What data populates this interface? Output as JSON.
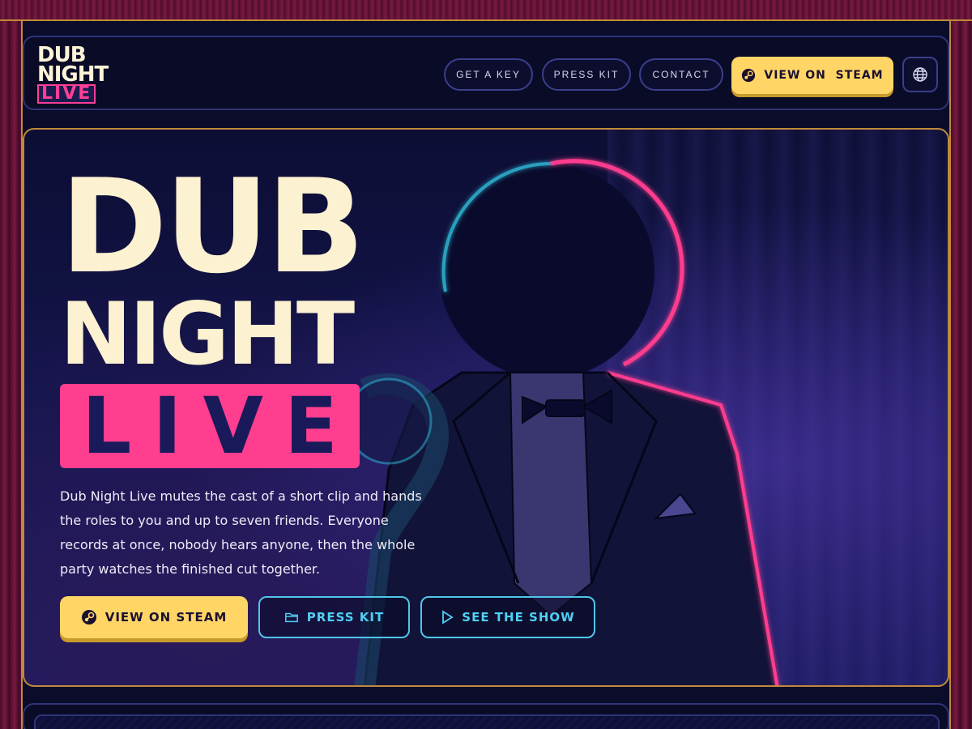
{
  "header": {
    "logo": {
      "line1": "DUB",
      "line2": "NIGHT",
      "line3": "LIVE"
    },
    "nav": [
      {
        "label": "GET A KEY"
      },
      {
        "label": "PRESS KIT"
      },
      {
        "label": "CONTACT"
      }
    ],
    "steam_button_label": "VIEW ON  STEAM",
    "globe_icon": "globe-icon"
  },
  "hero": {
    "title_line1": "DUB",
    "title_line2": "NIGHT",
    "title_line3_letters": [
      "L",
      "I",
      "V",
      "E"
    ],
    "description": "Dub Night Live mutes the cast of a short clip and hands the roles to you and up to seven friends. Everyone records at once, nobody hears anyone, then the whole party watches the finished cut together.",
    "buttons": {
      "steam": "VIEW ON STEAM",
      "press_kit": "PRESS KIT",
      "see_show": "SEE THE SHOW"
    }
  },
  "colors": {
    "accent_yellow": "#ffd566",
    "accent_pink": "#ff3e8f",
    "accent_cyan": "#4fc6ea",
    "background": "#0b0c2a"
  }
}
